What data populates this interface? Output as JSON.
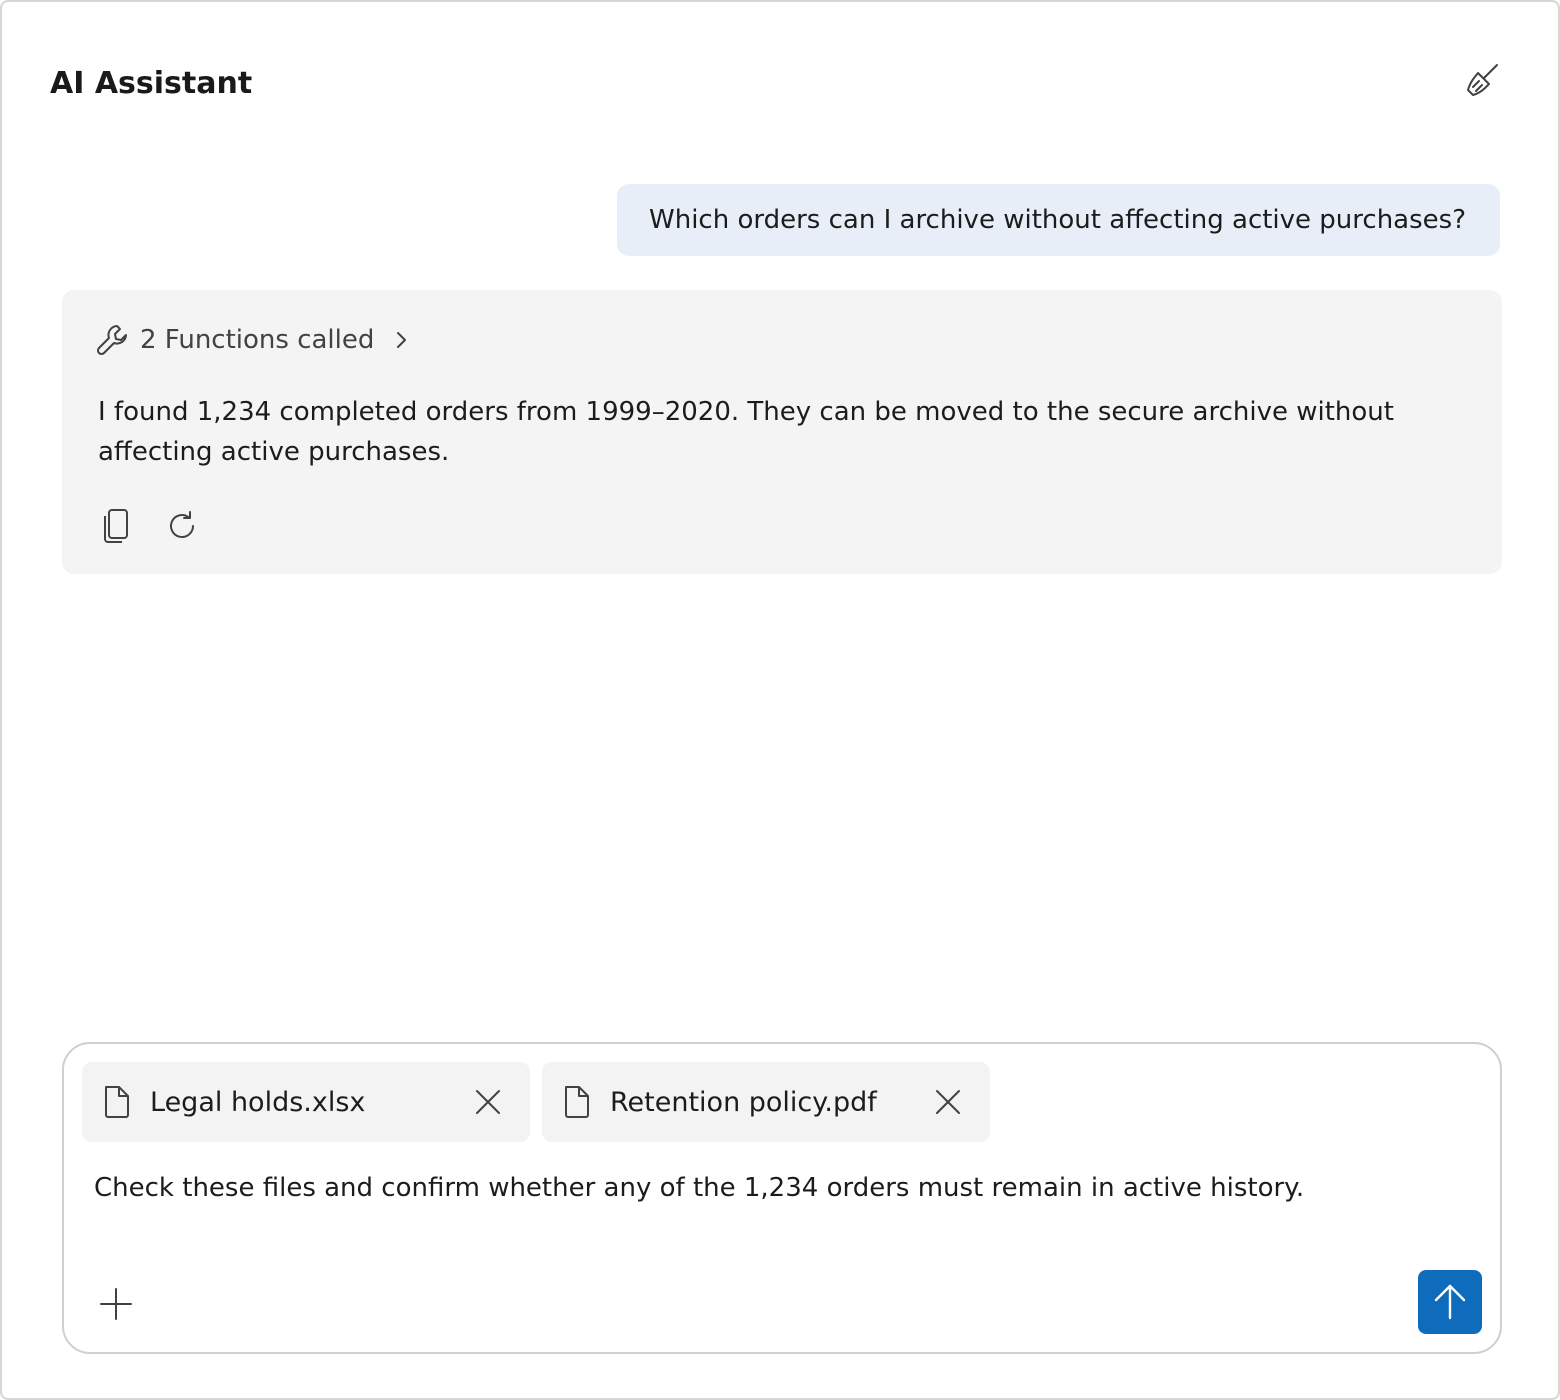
{
  "header": {
    "title": "AI Assistant",
    "clear_icon": "broom-icon"
  },
  "conversation": {
    "user_message": "Which orders can I archive without affecting active purchases?",
    "assistant": {
      "functions_label": "2 Functions called",
      "functions_icon": "wrench-icon",
      "answer": "I found 1,234 completed orders from 1999–2020. They can be moved to the secure archive without affecting active purchases.",
      "actions": [
        "copy-icon",
        "regenerate-icon"
      ]
    }
  },
  "composer": {
    "attachments": [
      {
        "name": "Legal holds.xlsx"
      },
      {
        "name": "Retention policy.pdf"
      }
    ],
    "input_value": "Check these files and confirm whether any of the 1,234 orders must remain in active history.",
    "add_icon": "plus-icon",
    "send_icon": "arrow-up-icon"
  },
  "colors": {
    "accent": "#0f6cbd",
    "user_bubble": "#e8eef7",
    "assistant_card": "#f4f4f4"
  }
}
